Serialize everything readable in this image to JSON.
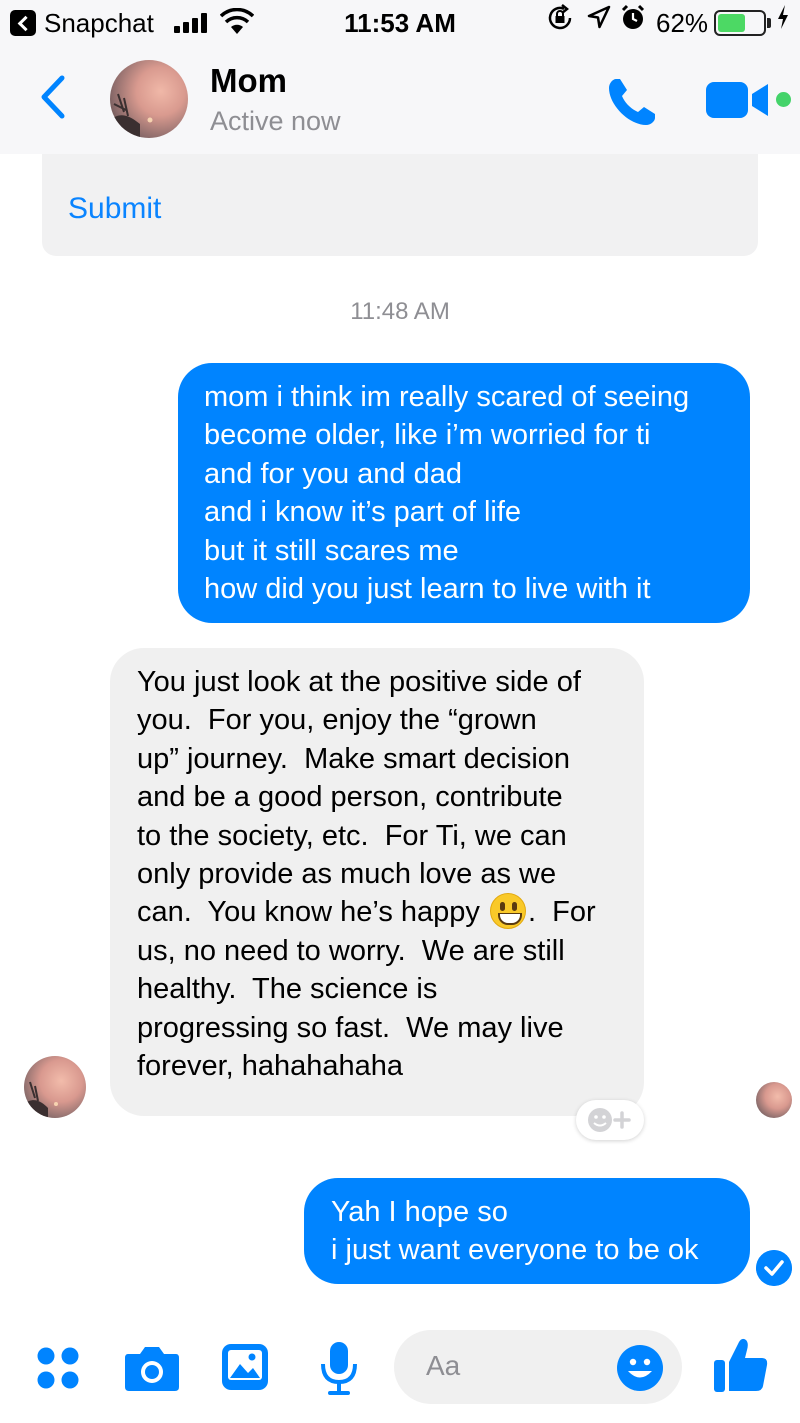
{
  "status_bar": {
    "back_app": "Snapchat",
    "time": "11:53 AM",
    "battery_percent": "62%",
    "battery_level": 0.62,
    "icons": [
      "signal-icon",
      "wifi-icon",
      "rotation-lock-icon",
      "location-icon",
      "alarm-icon",
      "battery-icon",
      "charging-icon"
    ]
  },
  "header": {
    "contact_name": "Mom",
    "contact_status": "Active now",
    "icons": [
      "back-chevron-icon",
      "phone-icon",
      "video-camera-icon"
    ],
    "accent_color": "#0084ff",
    "active_dot_color": "#44d36a"
  },
  "chat": {
    "card_link": "Submit",
    "timestamp": "11:48 AM",
    "messages": [
      {
        "direction": "outgoing",
        "text": "mom i think im really scared of seeing\nbecome older, like i’m worried for ti\nand for you and dad\nand i know it’s part of life\nbut it still scares me\nhow did you just learn to live with it"
      },
      {
        "direction": "incoming",
        "text_before_emoji": "You just look at the positive side of\nyou.  For you, enjoy the “grown\nup” journey.  Make smart decision\nand be a good person, contribute\nto the society, etc.  For Ti, we can\nonly provide as much love as we\ncan.  You know he’s happy ",
        "emoji": "smiley-emoji",
        "text_after_emoji": ".  For\nus, no need to worry.  We are still\nhealthy.  The science is\nprogressing so fast.  We may live\nforever, hahahahaha"
      },
      {
        "direction": "outgoing",
        "text": "Yah I hope so\ni just want everyone to be ok"
      }
    ],
    "outgoing_color": "#0084ff",
    "incoming_color": "#f0f0f0"
  },
  "composer": {
    "placeholder": "Aa",
    "icons": [
      "more-apps-icon",
      "camera-icon",
      "photo-icon",
      "microphone-icon",
      "emoji-icon",
      "thumbs-up-icon"
    ]
  }
}
